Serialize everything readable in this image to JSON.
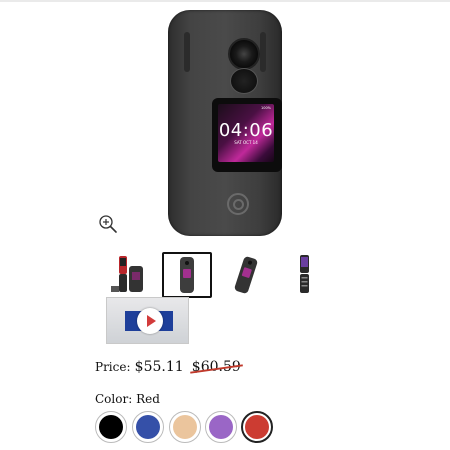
{
  "main_image": {
    "screen_time": "04:06",
    "screen_date": "SAT OCT 14",
    "screen_battery": "100%"
  },
  "icons": {
    "zoom": "zoom-in-icon",
    "play": "play-icon"
  },
  "thumbnails": [
    {
      "name": "thumbnail-phone-red-open",
      "selected": false
    },
    {
      "name": "thumbnail-phone-black-closed",
      "selected": true
    },
    {
      "name": "thumbnail-phone-angled",
      "selected": false
    },
    {
      "name": "thumbnail-phone-open",
      "selected": false
    },
    {
      "name": "thumbnail-video",
      "selected": false
    }
  ],
  "price": {
    "label": "Price:",
    "current": "$55.11",
    "original": "$60.59"
  },
  "color": {
    "label": "Color:",
    "selected": "Red",
    "swatches": [
      {
        "name": "Black",
        "hex": "#000000"
      },
      {
        "name": "Blue",
        "hex": "#3550a8"
      },
      {
        "name": "Tan",
        "hex": "#ebc59d"
      },
      {
        "name": "Purple",
        "hex": "#9a66c6"
      },
      {
        "name": "Red",
        "hex": "#cc3c32"
      }
    ]
  },
  "colors": {
    "strike": "#c0392b",
    "phone_body": "#444444"
  }
}
